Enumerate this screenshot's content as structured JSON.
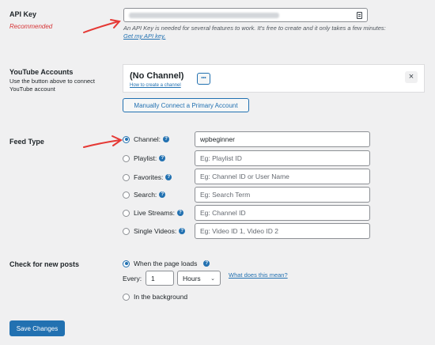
{
  "api_key": {
    "label": "API Key",
    "sublabel": "Recommended",
    "description": "An API Key is needed for several features to work. It's free to create and it only takes a few minutes:",
    "link": "Get my API key."
  },
  "youtube_accounts": {
    "label": "YouTube Accounts",
    "help": "Use the button above to connect YouTube account",
    "channel_name": "(No Channel)",
    "create_link": "How to create a channel",
    "more_label": "•••",
    "close_label": "×",
    "connect_button": "Manually Connect a Primary Account"
  },
  "feed_type": {
    "label": "Feed Type",
    "options": [
      {
        "label": "Channel:",
        "value": "wpbeginner",
        "placeholder": "",
        "checked": true
      },
      {
        "label": "Playlist:",
        "value": "",
        "placeholder": "Eg: Playlist ID",
        "checked": false
      },
      {
        "label": "Favorites:",
        "value": "",
        "placeholder": "Eg: Channel ID or User Name",
        "checked": false
      },
      {
        "label": "Search:",
        "value": "",
        "placeholder": "Eg: Search Term",
        "checked": false
      },
      {
        "label": "Live Streams:",
        "value": "",
        "placeholder": "Eg: Channel ID",
        "checked": false
      },
      {
        "label": "Single Videos:",
        "value": "",
        "placeholder": "Eg: Video ID 1, Video ID 2",
        "checked": false
      }
    ]
  },
  "check_posts": {
    "label": "Check for new posts",
    "option_page_load": "When the page loads",
    "every_label": "Every:",
    "every_value": "1",
    "unit_value": "Hours",
    "what_link": "What does this mean?",
    "option_background": "In the background"
  },
  "save_button": "Save Changes",
  "colors": {
    "accent": "#2271b1",
    "arrow": "#e53935",
    "required": "#d63638"
  }
}
